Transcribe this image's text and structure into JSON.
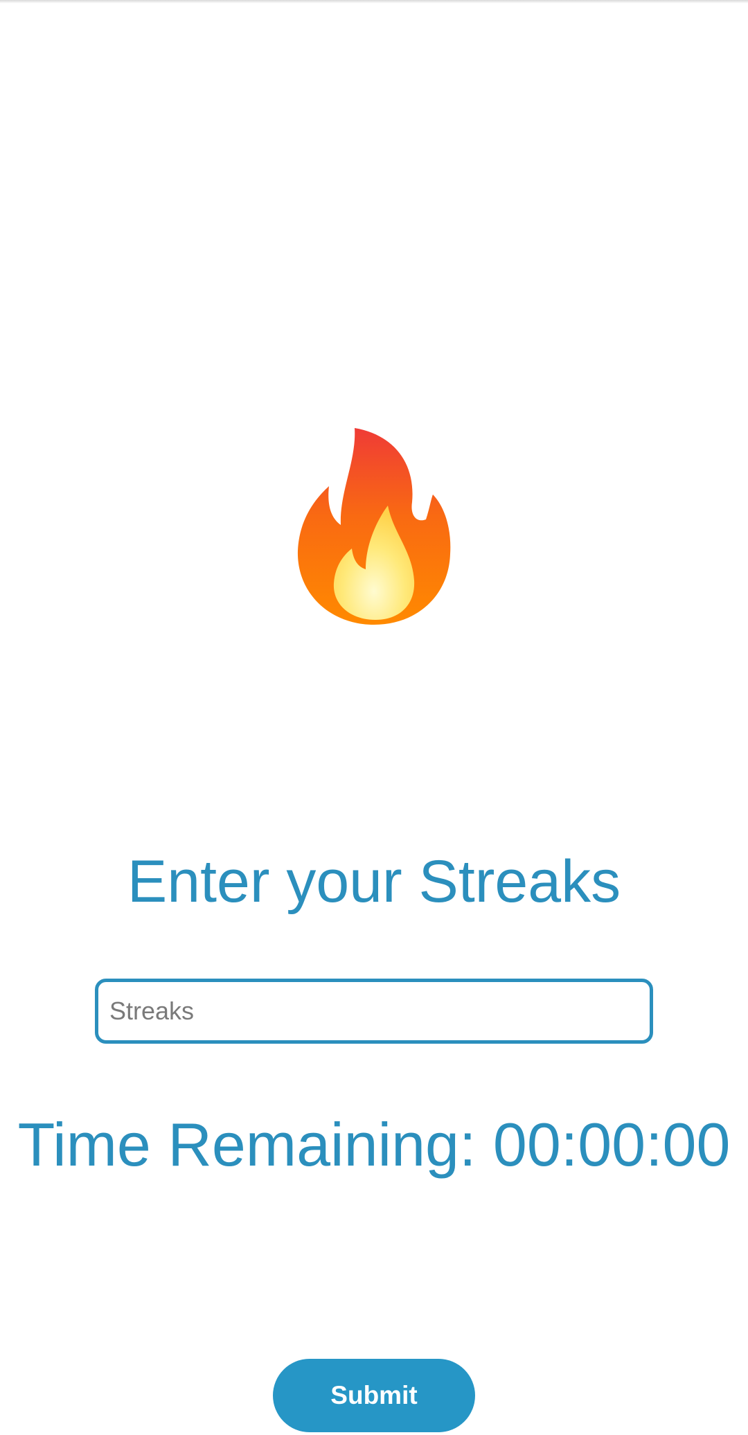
{
  "streak": {
    "icon": "fire-icon",
    "heading": "Enter your Streaks",
    "input_placeholder": "Streaks",
    "input_value": "",
    "timer_label": "Time Remaining: 00:00:00",
    "submit_label": "Submit"
  },
  "colors": {
    "accent": "#2b8fbd",
    "button": "#2696c6",
    "background": "#ffffff"
  }
}
